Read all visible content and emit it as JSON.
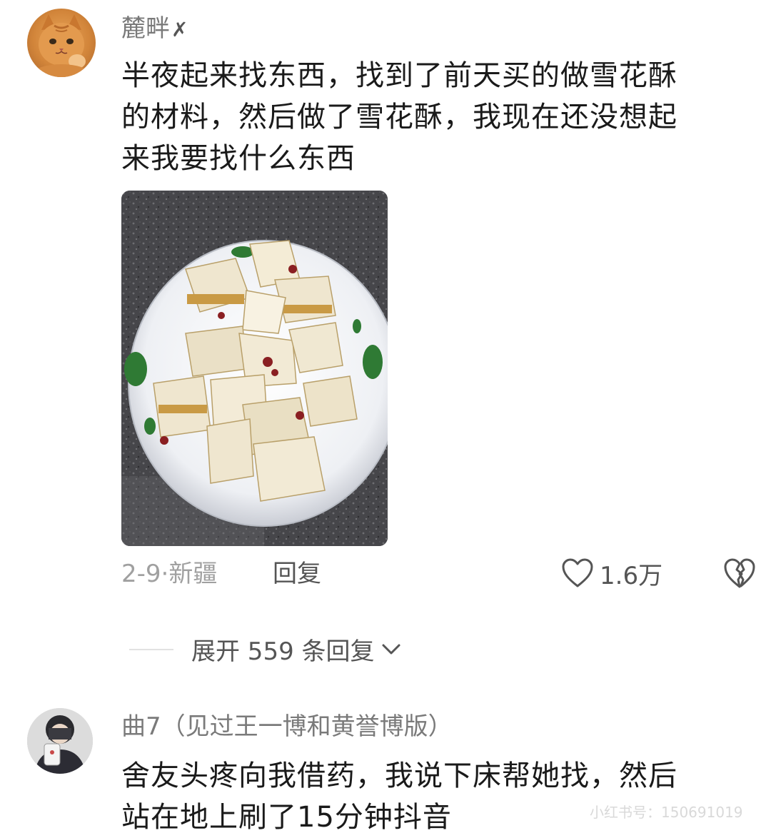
{
  "comments": [
    {
      "username": "麓畔",
      "badge": "✗",
      "lines": [
        "半夜起来找东西，找到了前天买的做雪花酥",
        "的材料，然后做了雪花酥，我现在还没想起",
        "来我要找什么东西"
      ],
      "date_location": "2-9·新疆",
      "reply_label": "回复",
      "like_count": "1.6万",
      "has_photo": true
    },
    {
      "username": "曲7（见过王一博和黄誉博版）",
      "lines": [
        "舍友头疼向我借药，我说下床帮她找，然后",
        "站在地上刷了15分钟抖音"
      ]
    }
  ],
  "expand": {
    "label": "展开 559 条回复"
  },
  "watermark": "小红书号：150691019",
  "icons": {
    "like": "heart-outline-icon",
    "dislike": "broken-heart-icon",
    "expand": "chevron-down-icon"
  },
  "colors": {
    "username": "#7a7a7a",
    "body_text": "#1a1a1a",
    "meta": "#a0a0a0",
    "action": "#555555"
  }
}
